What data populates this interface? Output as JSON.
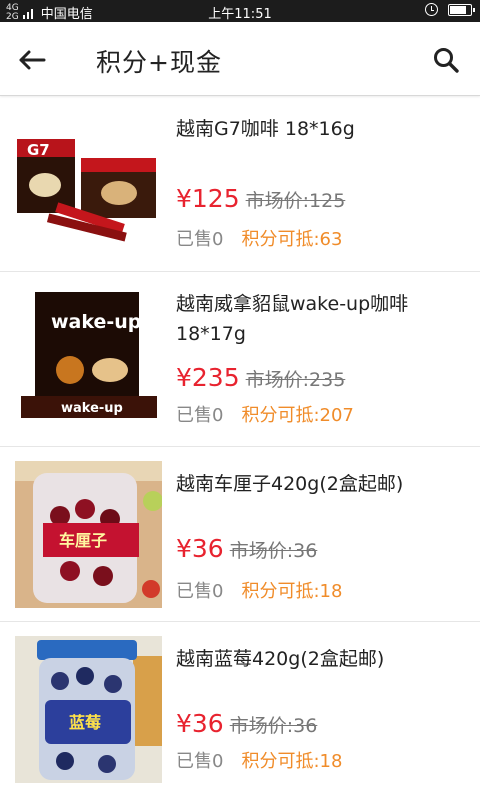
{
  "status": {
    "net_top": "4G",
    "net_bottom": "2G",
    "carrier": "中国电信",
    "time": "上午11:51",
    "battery_level": 0.85
  },
  "header": {
    "title": "积分+现金"
  },
  "products": [
    {
      "name": "越南G7咖啡  18*16g",
      "price": "¥125",
      "market": "市场价:125",
      "sold": "已售0",
      "points": "积分可抵:63",
      "image_text": "G7"
    },
    {
      "name": "越南威拿貂鼠wake-up咖啡18*17g",
      "price": "¥235",
      "market": "市场价:235",
      "sold": "已售0",
      "points": "积分可抵:207",
      "image_text": "wake-up"
    },
    {
      "name": "越南车厘子420g(2盒起邮)",
      "price": "¥36",
      "market": "市场价:36",
      "sold": "已售0",
      "points": "积分可抵:18",
      "image_text": "车厘子"
    },
    {
      "name": "越南蓝莓420g(2盒起邮)",
      "price": "¥36",
      "market": "市场价:36",
      "sold": "已售0",
      "points": "积分可抵:18",
      "image_text": "蓝莓"
    }
  ],
  "colors": {
    "price": "#e8232f",
    "points": "#f08c2a",
    "statusbar": "#1c1c1c"
  }
}
